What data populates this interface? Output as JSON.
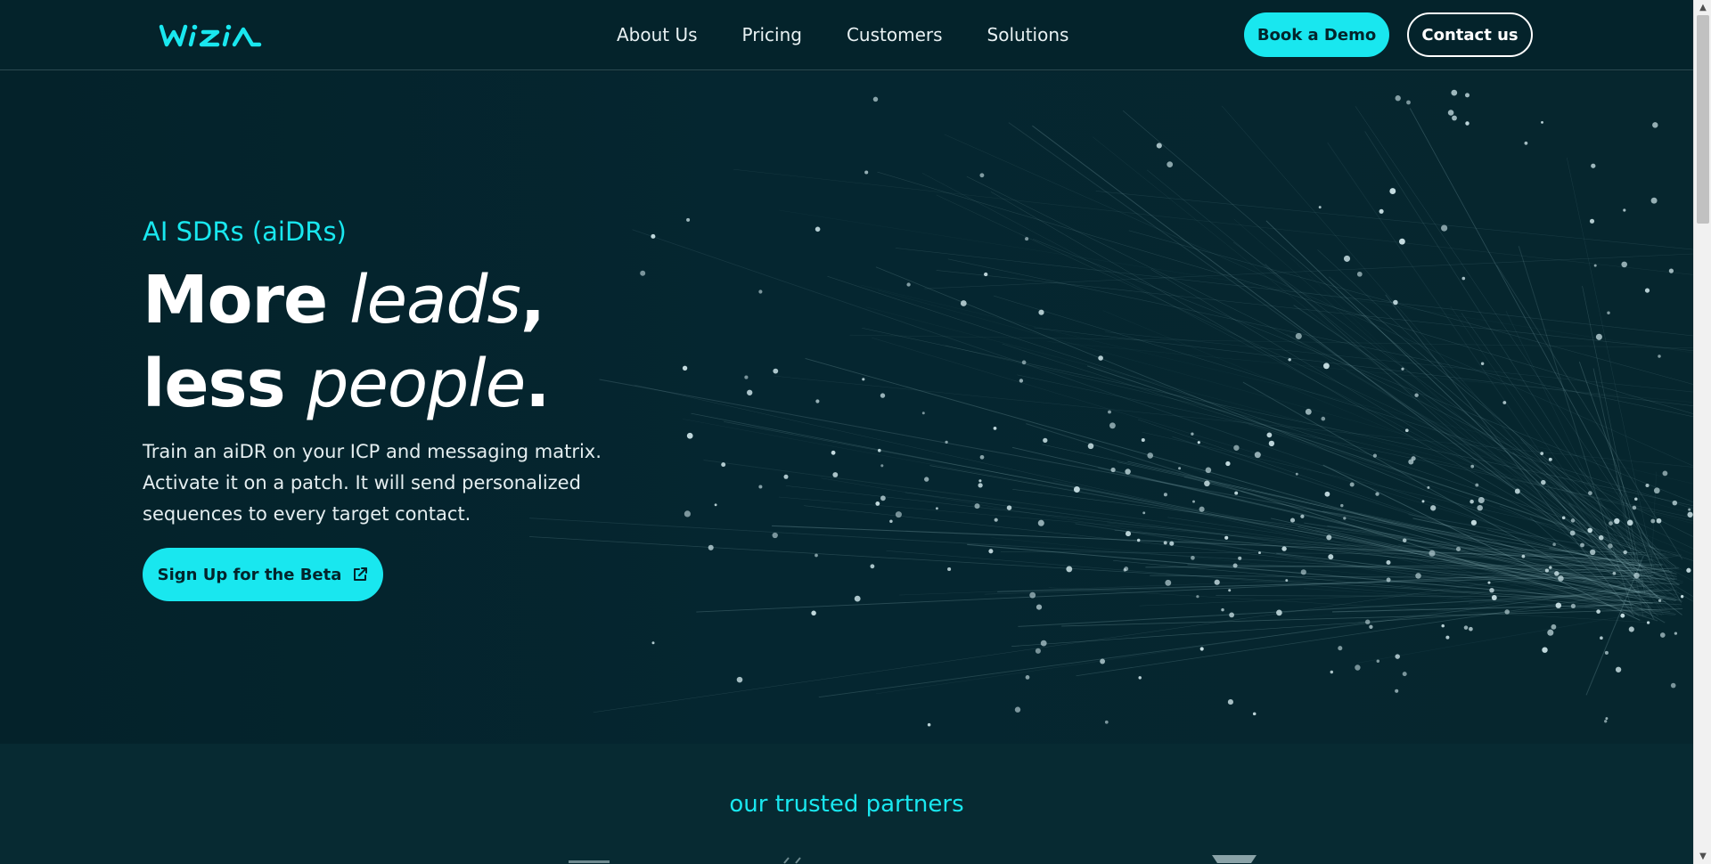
{
  "header": {
    "nav": [
      {
        "label": "About Us"
      },
      {
        "label": "Pricing"
      },
      {
        "label": "Customers"
      },
      {
        "label": "Solutions"
      }
    ],
    "book_demo_label": "Book a Demo",
    "contact_label": "Contact us"
  },
  "hero": {
    "eyebrow": "AI SDRs (aiDRs)",
    "title": {
      "word1": "More",
      "word2": "leads",
      "sep1": ",",
      "word3": "less",
      "word4": "people",
      "sep2": "."
    },
    "description": "Train an aiDR on your ICP and messaging matrix. Activate it on a patch. It will send personalized sequences to every target contact.",
    "cta_label": "Sign Up for the Beta"
  },
  "partners": {
    "title": "our trusted partners"
  },
  "colors": {
    "accent": "#19e7ef",
    "background": "#062229",
    "header_bg": "#04232b",
    "partners_bg": "#072a32"
  },
  "icons": {
    "logo": "wizia-logo",
    "cta": "external-link-icon"
  }
}
